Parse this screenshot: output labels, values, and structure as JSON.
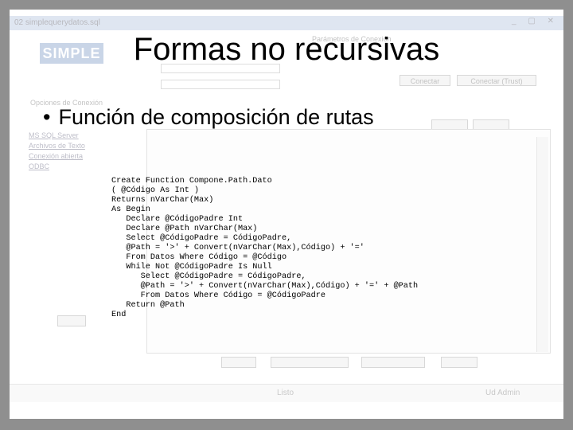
{
  "slide": {
    "title": "Formas no recursivas",
    "bullet": "Función de composición de rutas",
    "code_lines": [
      "Create Function Compone.Path.Dato",
      "( @Código As Int )",
      "Returns nVarChar(Max)",
      "As Begin",
      "   Declare @CódigoPadre Int",
      "   Declare @Path nVarChar(Max)",
      "   Select @CódigoPadre = CódigoPadre,",
      "   @Path = '>' + Convert(nVarChar(Max),Código) + '='",
      "   From Datos Where Código = @Código",
      "   While Not @CódigoPadre Is Null",
      "      Select @CódigoPadre = CódigoPadre,",
      "      @Path = '>' + Convert(nVarChar(Max),Código) + '=' + @Path",
      "      From Datos Where Código = @CódigoPadre",
      "   Return @Path",
      "End"
    ]
  },
  "background_app": {
    "window_title": "02 simplequerydatos.sql",
    "logo": "SIMPLE",
    "panel_title": "Parámetros de Conexión",
    "connect_button": "Conectar",
    "connect_trust_button": "Conectar (Trust)",
    "section_label": "Opciones de Conexión",
    "left_list": [
      "MS SQL Server",
      "Archivos de Texto",
      "Conexión abierta",
      "ODBC"
    ],
    "status_left": "Listo",
    "status_right": "Ud Admin"
  },
  "colors": {
    "frame": "#8f8f8f",
    "slide_background": "#ffffff",
    "text": "#000000"
  }
}
